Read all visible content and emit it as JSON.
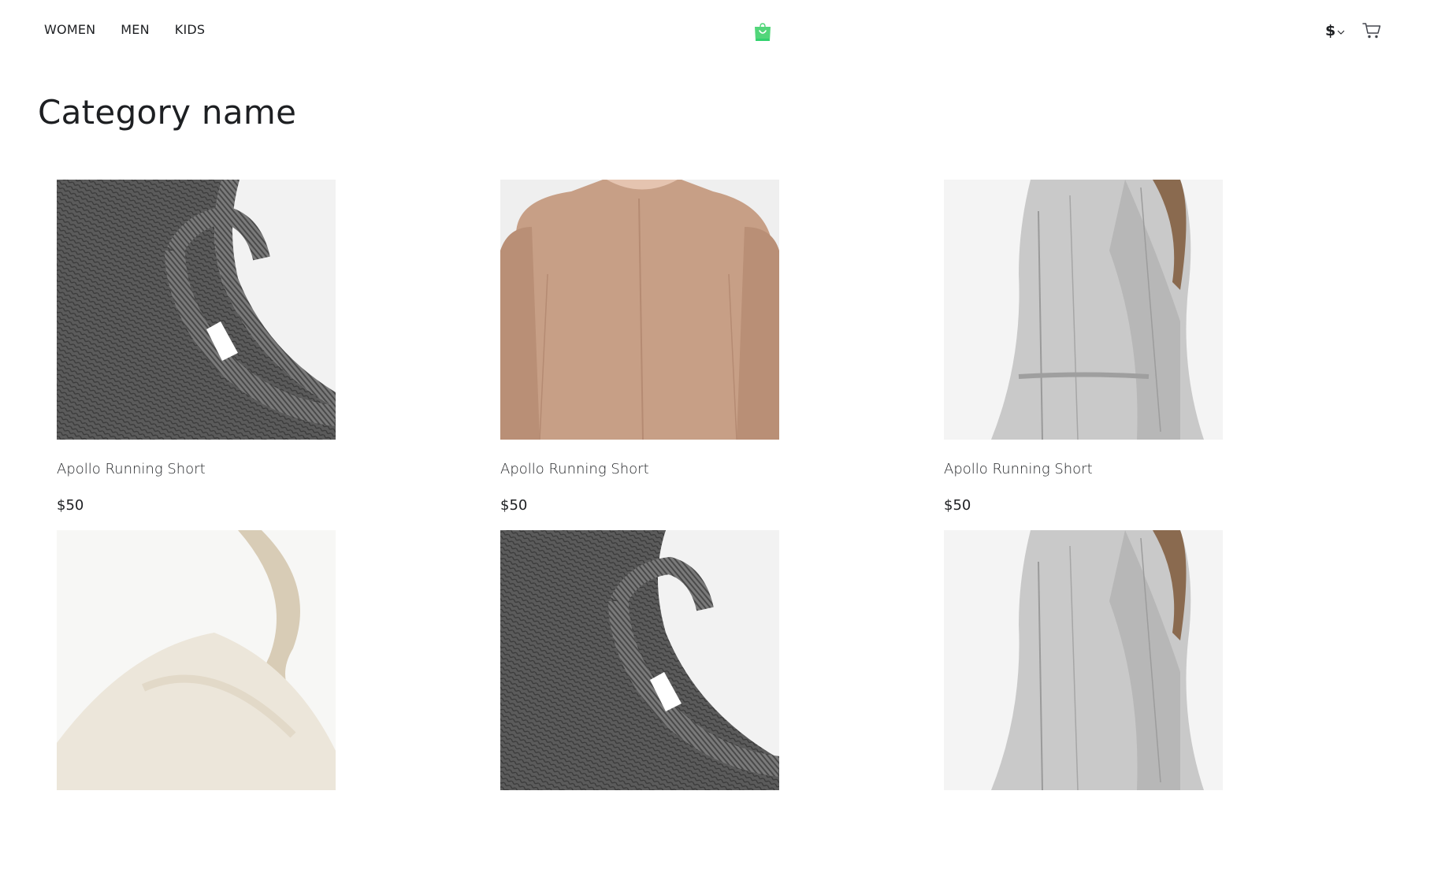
{
  "nav": {
    "items": [
      "WOMEN",
      "MEN",
      "KIDS"
    ]
  },
  "logo": {
    "icon": "shopping-bag-logo-icon",
    "color": "#52d67a"
  },
  "currency": {
    "symbol": "$",
    "icon": "chevron-down-icon"
  },
  "cart": {
    "icon": "cart-icon"
  },
  "category": {
    "title": "Category name"
  },
  "products": [
    {
      "name": "Apollo Running Short",
      "price": "$50",
      "image": "grey-knit-sweater"
    },
    {
      "name": "Apollo Running Short",
      "price": "$50",
      "image": "beige-sweater"
    },
    {
      "name": "Apollo Running Short",
      "price": "$50",
      "image": "grey-shirt-dress"
    },
    {
      "name": "",
      "price": "",
      "image": "canvas-tote-bag"
    },
    {
      "name": "",
      "price": "",
      "image": "grey-knit-sweater"
    },
    {
      "name": "",
      "price": "",
      "image": "grey-shirt-dress"
    }
  ]
}
